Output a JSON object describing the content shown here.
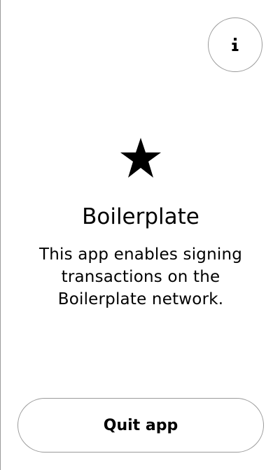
{
  "header": {
    "info_button": {
      "icon": "info-icon",
      "label": "i"
    }
  },
  "app": {
    "icon": "star-icon",
    "title": "Boilerplate",
    "description": "This app enables signing transactions on the Boilerplate network."
  },
  "footer": {
    "quit_label": "Quit app"
  },
  "colors": {
    "background": "#ffffff",
    "text": "#000000",
    "border": "#9a9a9a"
  }
}
